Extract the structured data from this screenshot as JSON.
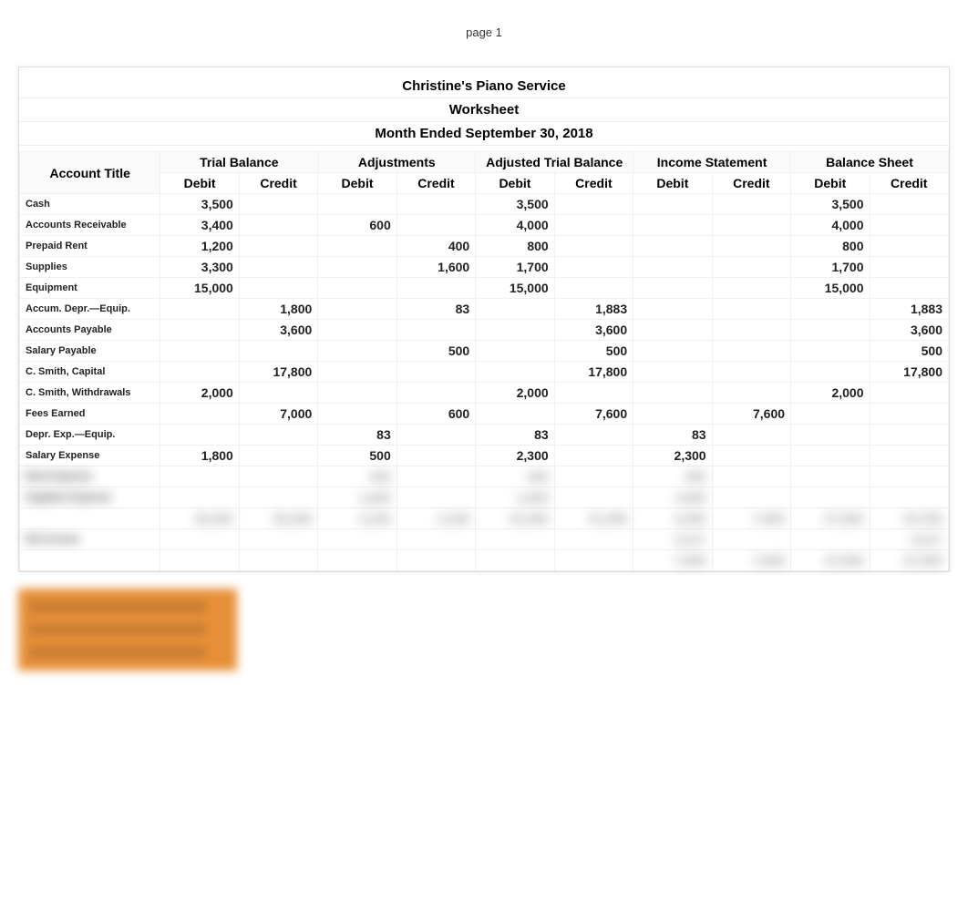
{
  "page_label": "page 1",
  "title1": "Christine's Piano Service",
  "title2": "Worksheet",
  "title3": "Month Ended September 30, 2018",
  "account_title_header": "Account Title",
  "sections": [
    "Trial Balance",
    "Adjustments",
    "Adjusted Trial Balance",
    "Income Statement",
    "Balance Sheet"
  ],
  "dc": {
    "debit": "Debit",
    "credit": "Credit"
  },
  "rows": [
    {
      "acct": "Cash",
      "tb_d": "3,500",
      "tb_c": "",
      "adj_d": "",
      "adj_c": "",
      "atb_d": "3,500",
      "atb_c": "",
      "is_d": "",
      "is_c": "",
      "bs_d": "3,500",
      "bs_c": ""
    },
    {
      "acct": "Accounts Receivable",
      "tb_d": "3,400",
      "tb_c": "",
      "adj_d": "600",
      "adj_c": "",
      "atb_d": "4,000",
      "atb_c": "",
      "is_d": "",
      "is_c": "",
      "bs_d": "4,000",
      "bs_c": ""
    },
    {
      "acct": "Prepaid Rent",
      "tb_d": "1,200",
      "tb_c": "",
      "adj_d": "",
      "adj_c": "400",
      "atb_d": "800",
      "atb_c": "",
      "is_d": "",
      "is_c": "",
      "bs_d": "800",
      "bs_c": ""
    },
    {
      "acct": "Supplies",
      "tb_d": "3,300",
      "tb_c": "",
      "adj_d": "",
      "adj_c": "1,600",
      "atb_d": "1,700",
      "atb_c": "",
      "is_d": "",
      "is_c": "",
      "bs_d": "1,700",
      "bs_c": ""
    },
    {
      "acct": "Equipment",
      "tb_d": "15,000",
      "tb_c": "",
      "adj_d": "",
      "adj_c": "",
      "atb_d": "15,000",
      "atb_c": "",
      "is_d": "",
      "is_c": "",
      "bs_d": "15,000",
      "bs_c": ""
    },
    {
      "acct": "Accum. Depr.—Equip.",
      "tb_d": "",
      "tb_c": "1,800",
      "adj_d": "",
      "adj_c": "83",
      "atb_d": "",
      "atb_c": "1,883",
      "is_d": "",
      "is_c": "",
      "bs_d": "",
      "bs_c": "1,883"
    },
    {
      "acct": "Accounts Payable",
      "tb_d": "",
      "tb_c": "3,600",
      "adj_d": "",
      "adj_c": "",
      "atb_d": "",
      "atb_c": "3,600",
      "is_d": "",
      "is_c": "",
      "bs_d": "",
      "bs_c": "3,600"
    },
    {
      "acct": "Salary Payable",
      "tb_d": "",
      "tb_c": "",
      "adj_d": "",
      "adj_c": "500",
      "atb_d": "",
      "atb_c": "500",
      "is_d": "",
      "is_c": "",
      "bs_d": "",
      "bs_c": "500"
    },
    {
      "acct": "C. Smith, Capital",
      "tb_d": "",
      "tb_c": "17,800",
      "adj_d": "",
      "adj_c": "",
      "atb_d": "",
      "atb_c": "17,800",
      "is_d": "",
      "is_c": "",
      "bs_d": "",
      "bs_c": "17,800"
    },
    {
      "acct": "C. Smith, Withdrawals",
      "tb_d": "2,000",
      "tb_c": "",
      "adj_d": "",
      "adj_c": "",
      "atb_d": "2,000",
      "atb_c": "",
      "is_d": "",
      "is_c": "",
      "bs_d": "2,000",
      "bs_c": ""
    },
    {
      "acct": "Fees Earned",
      "tb_d": "",
      "tb_c": "7,000",
      "adj_d": "",
      "adj_c": "600",
      "atb_d": "",
      "atb_c": "7,600",
      "is_d": "",
      "is_c": "7,600",
      "bs_d": "",
      "bs_c": ""
    },
    {
      "acct": "Depr. Exp.—Equip.",
      "tb_d": "",
      "tb_c": "",
      "adj_d": "83",
      "adj_c": "",
      "atb_d": "83",
      "atb_c": "",
      "is_d": "83",
      "is_c": "",
      "bs_d": "",
      "bs_c": ""
    },
    {
      "acct": "Salary Expense",
      "tb_d": "1,800",
      "tb_c": "",
      "adj_d": "500",
      "adj_c": "",
      "atb_d": "2,300",
      "atb_c": "",
      "is_d": "2,300",
      "is_c": "",
      "bs_d": "",
      "bs_c": ""
    }
  ],
  "blurred_rows": [
    {
      "acct": "Rent Expense",
      "tb_d": "",
      "tb_c": "",
      "adj_d": "400",
      "adj_c": "",
      "atb_d": "400",
      "atb_c": "",
      "is_d": "400",
      "is_c": "",
      "bs_d": "",
      "bs_c": ""
    },
    {
      "acct": "Supplies Expense",
      "tb_d": "",
      "tb_c": "",
      "adj_d": "1,600",
      "adj_c": "",
      "atb_d": "1,600",
      "atb_c": "",
      "is_d": "1,600",
      "is_c": "",
      "bs_d": "",
      "bs_c": ""
    },
    {
      "acct": "",
      "tb_d": "30,200",
      "tb_c": "30,200",
      "adj_d": "3,183",
      "adj_c": "3,183",
      "atb_d": "31,383",
      "atb_c": "31,383",
      "is_d": "4,383",
      "is_c": "7,600",
      "bs_d": "27,000",
      "bs_c": "23,783"
    },
    {
      "acct": "Net Income",
      "tb_d": "",
      "tb_c": "",
      "adj_d": "",
      "adj_c": "",
      "atb_d": "",
      "atb_c": "",
      "is_d": "3,217",
      "is_c": "",
      "bs_d": "",
      "bs_c": "3,217"
    },
    {
      "acct": "",
      "tb_d": "",
      "tb_c": "",
      "adj_d": "",
      "adj_c": "",
      "atb_d": "",
      "atb_c": "",
      "is_d": "7,600",
      "is_c": "7,600",
      "bs_d": "27,000",
      "bs_c": "27,000"
    }
  ]
}
